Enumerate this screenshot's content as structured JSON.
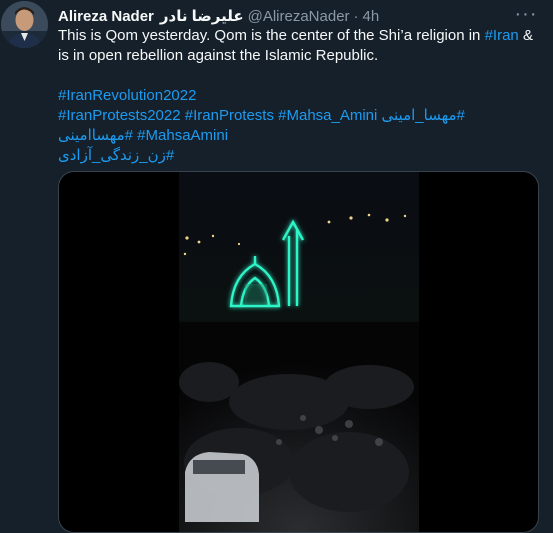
{
  "author": {
    "name": "Alireza Nader",
    "name_fa": "علیرضا نادر",
    "handle": "@AlirezaNader",
    "separator": "·",
    "time": "4h"
  },
  "more_label": "···",
  "tweet": {
    "line1_prefix": "This is Qom yesterday. Qom is the center of the Shi’a religion in ",
    "line1_link": "#Iran",
    "line1_suffix": " & is in open rebellion against the Islamic Republic.",
    "hashtags": {
      "h1": "#IranRevolution2022",
      "h2": "#IranProtests2022",
      "h3": "#IranProtests",
      "h4": "#Mahsa_Amini",
      "h5": "#مهسا_امینی",
      "h6": "#مهساامینی",
      "h7": "#MahsaAmini",
      "h8": "#زن_زندگی_آزادی"
    }
  },
  "colors": {
    "background": "#15202b",
    "text": "#f7f9f9",
    "secondary": "#8b98a5",
    "link": "#1d9bf0",
    "border": "#38444d",
    "neon": "#2ef5c7"
  }
}
